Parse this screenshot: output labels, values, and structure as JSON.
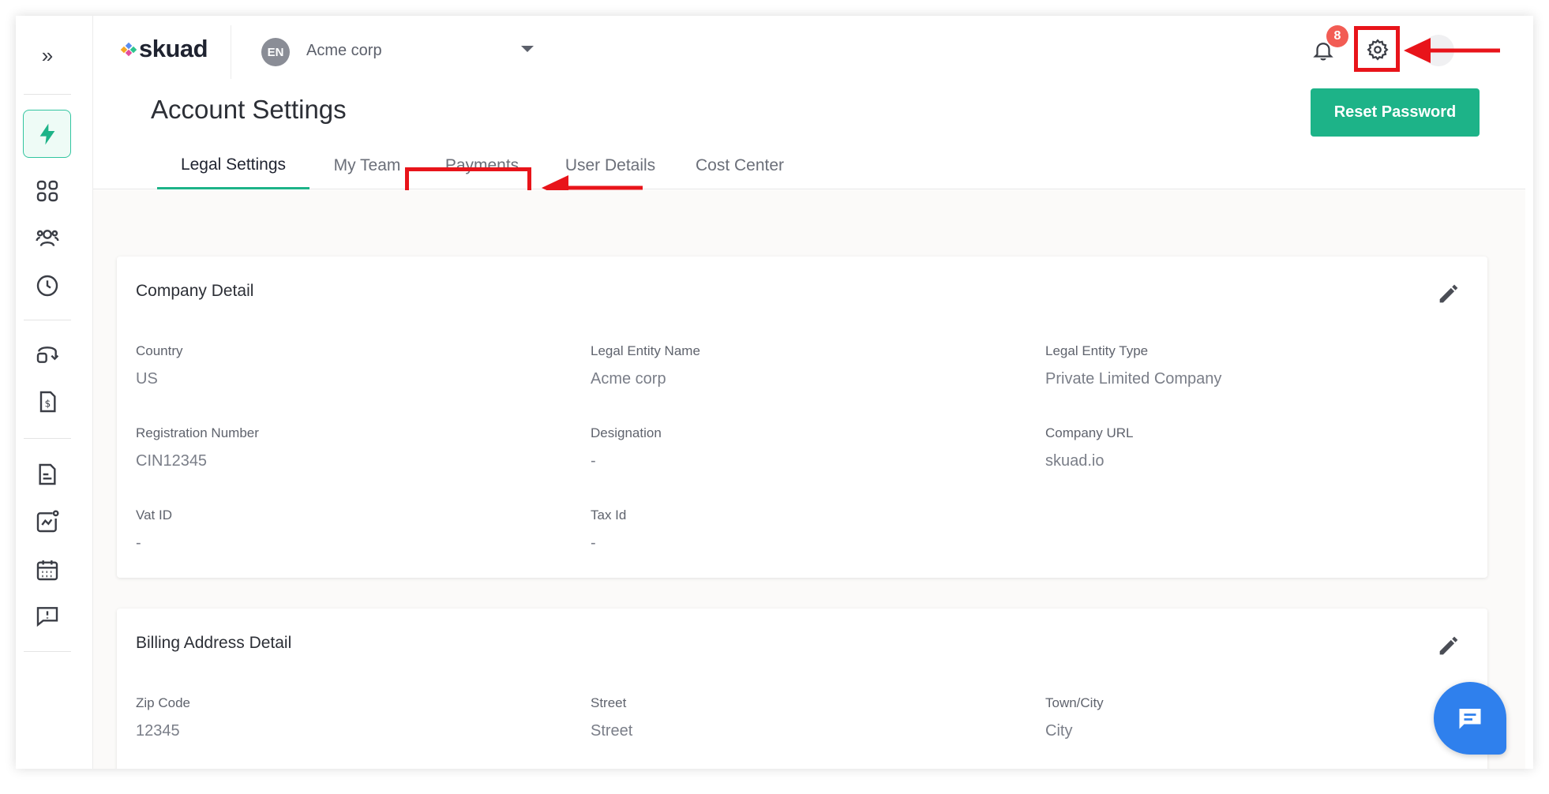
{
  "header": {
    "logo_text": "skuad",
    "org_initials": "EN",
    "org_name": "Acme corp",
    "notification_count": "8"
  },
  "page": {
    "title": "Account Settings",
    "reset_button": "Reset Password"
  },
  "tabs": [
    {
      "label": "Legal Settings",
      "active": true
    },
    {
      "label": "My Team"
    },
    {
      "label": "Payments"
    },
    {
      "label": "User Details"
    },
    {
      "label": "Cost Center"
    }
  ],
  "company_detail": {
    "title": "Company Detail",
    "fields": [
      {
        "label": "Country",
        "value": "US"
      },
      {
        "label": "Legal Entity Name",
        "value": "Acme corp"
      },
      {
        "label": "Legal Entity Type",
        "value": "Private Limited Company"
      },
      {
        "label": "Registration Number",
        "value": "CIN12345"
      },
      {
        "label": "Designation",
        "value": "-"
      },
      {
        "label": "Company URL",
        "value": "skuad.io"
      },
      {
        "label": "Vat ID",
        "value": "-"
      },
      {
        "label": "Tax Id",
        "value": "-"
      }
    ]
  },
  "billing_detail": {
    "title": "Billing Address Detail",
    "fields": [
      {
        "label": "Zip Code",
        "value": "12345"
      },
      {
        "label": "Street",
        "value": "Street"
      },
      {
        "label": "Town/City",
        "value": "City"
      }
    ]
  },
  "sidebar": {
    "icons": [
      "lightning-icon",
      "dashboard-grid-icon",
      "team-icon",
      "clock-icon",
      "wallet-icon",
      "invoice-dollar-icon",
      "document-icon",
      "analytics-icon",
      "calendar-icon",
      "feedback-icon"
    ]
  },
  "colors": {
    "accent": "#1db388",
    "annotation": "#e8141a",
    "chat": "#2f80ed",
    "badge": "#f25c54"
  }
}
